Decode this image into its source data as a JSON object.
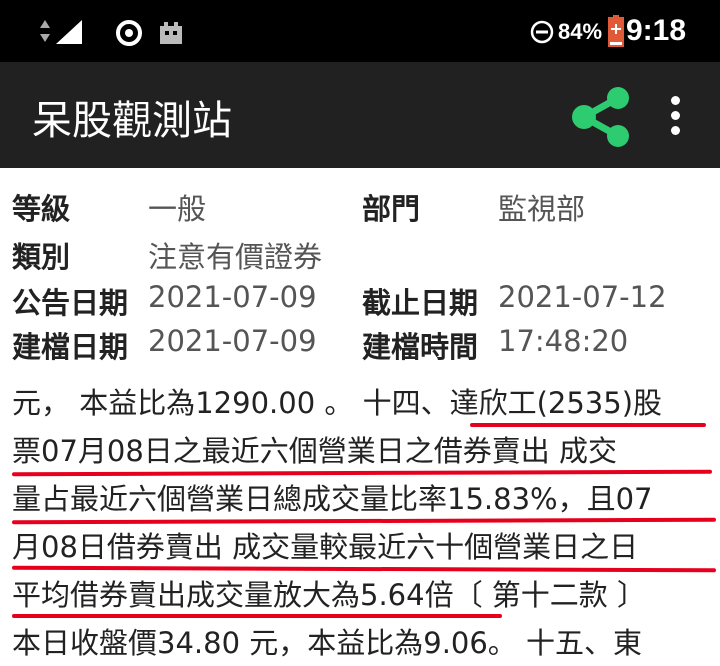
{
  "status": {
    "battery": "84%",
    "time": "9:18"
  },
  "app": {
    "title": "呆股觀測站"
  },
  "info": {
    "level_label": "等級",
    "level_value": "一般",
    "dept_label": "部門",
    "dept_value": "監視部",
    "type_label": "類別",
    "type_value": "注意有價證券",
    "announce_label": "公告日期",
    "announce_value": "2021-07-09",
    "deadline_label": "截止日期",
    "deadline_value": "2021-07-12",
    "created_date_label": "建檔日期",
    "created_date_value": "2021-07-09",
    "created_time_label": "建檔時間",
    "created_time_value": "17:48:20"
  },
  "content": {
    "lines": [
      "元， 本益比為1290.00 。 十四、達欣工(2535)股",
      "票07月08日之最近六個營業日之借券賣出 成交",
      "量占最近六個營業日總成交量比率15.83%，且07",
      "月08日借券賣出 成交量較最近六十個營業日之日",
      "平均借券賣出成交量放大為5.64倍〔 第十二款 〕",
      "本日收盤價34.80 元，本益比為9.06。 十五、東"
    ]
  },
  "colors": {
    "accent": "#2ecc71",
    "underline": "#e6001e",
    "appbar": "#212121"
  }
}
